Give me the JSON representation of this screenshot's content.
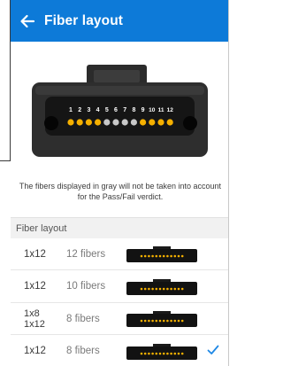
{
  "header": {
    "title": "Fiber layout",
    "background": "#0d7ad8"
  },
  "connector": {
    "fiber_numbers": [
      "1",
      "2",
      "3",
      "4",
      "5",
      "6",
      "7",
      "8",
      "9",
      "10",
      "11",
      "12"
    ],
    "fiber_states": [
      "active",
      "active",
      "active",
      "active",
      "inactive",
      "inactive",
      "inactive",
      "inactive",
      "active",
      "active",
      "active",
      "active"
    ],
    "active_color": "#f5b000",
    "inactive_color": "#c8c8c8"
  },
  "note": "The fibers displayed in gray will not be taken into account for the Pass/Fail verdict.",
  "section_title": "Fiber layout",
  "layouts": [
    {
      "type_lines": [
        "1x12"
      ],
      "fibers": "12 fibers",
      "selected": false
    },
    {
      "type_lines": [
        "1x12"
      ],
      "fibers": "10 fibers",
      "selected": false
    },
    {
      "type_lines": [
        "1x8",
        "1x12"
      ],
      "fibers": "8 fibers",
      "selected": false
    },
    {
      "type_lines": [
        "1x12"
      ],
      "fibers": "8 fibers",
      "selected": true
    }
  ],
  "icons": {
    "back": "arrow-left-icon",
    "selected": "checkmark-icon"
  },
  "accent_color": "#1e88e5"
}
